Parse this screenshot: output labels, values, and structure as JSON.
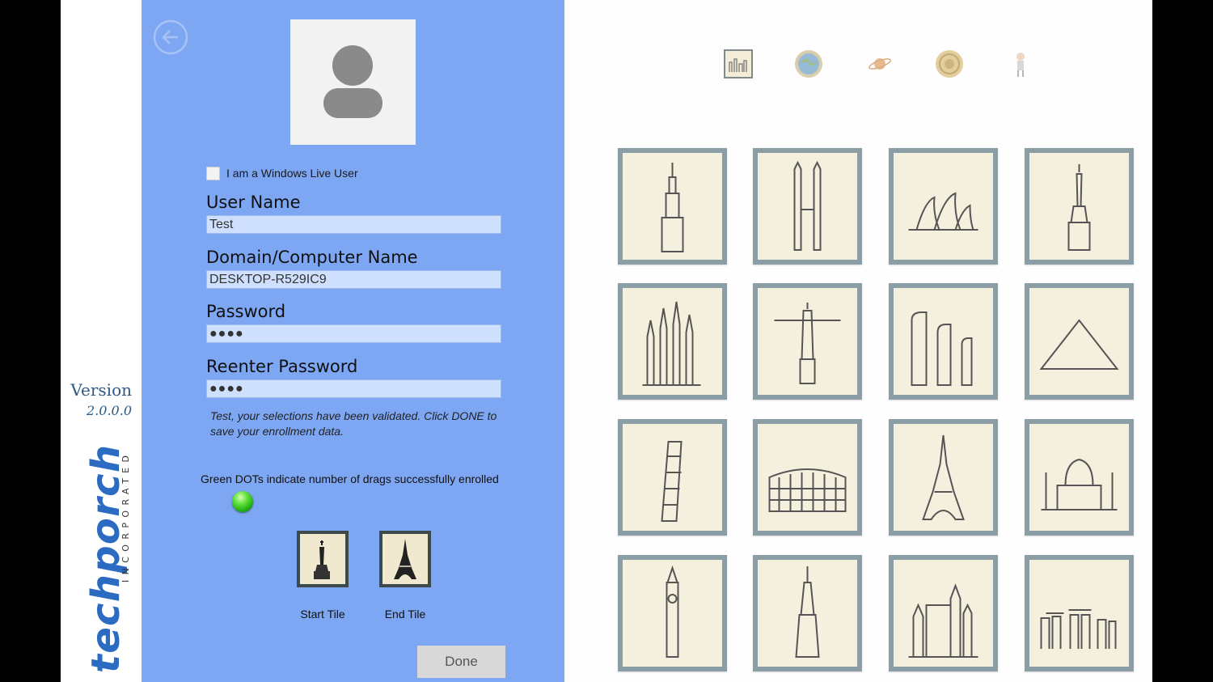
{
  "version": {
    "label": "Version",
    "number": "2.0.0.0"
  },
  "brand": {
    "logo_text": "techporch",
    "sub_text": "INCORPORATED"
  },
  "enroll": {
    "windows_live_label": "I am a Windows Live User",
    "windows_live_checked": false,
    "username_label": "User Name",
    "username_value": "Test",
    "domain_label": "Domain/Computer Name",
    "domain_value": "DESKTOP-R529IC9",
    "password_label": "Password",
    "password_value": "●●●●",
    "reenter_label": "Reenter Password",
    "reenter_value": "●●●●",
    "validation_message": "Test, your selections have been validated. Click DONE to save your enrollment data.",
    "dots_note": "Green DOTs indicate number of drags successfully enrolled",
    "enrolled_drags": 1,
    "start_tile_label": "Start Tile",
    "end_tile_label": "End Tile",
    "done_label": "Done"
  },
  "theme_icons": [
    "landmarks-theme-icon",
    "globe-theme-icon",
    "planet-theme-icon",
    "lion-seal-theme-icon",
    "mascot-theme-icon"
  ],
  "tiles": [
    "empire-state-building",
    "petronas-towers",
    "sydney-opera-house",
    "statue-of-liberty",
    "sagrada-familia",
    "christ-the-redeemer",
    "easter-island-moai",
    "pyramid",
    "leaning-tower-of-pisa",
    "colosseum",
    "eiffel-tower",
    "taj-mahal",
    "big-ben",
    "burj-khalifa",
    "neuschwanstein-castle",
    "stonehenge"
  ],
  "colors": {
    "panel": "#7ea7f3",
    "tile_frame": "#8b9ea5",
    "tile_bg": "#f5f0de",
    "brand_blue": "#2b5a86"
  }
}
